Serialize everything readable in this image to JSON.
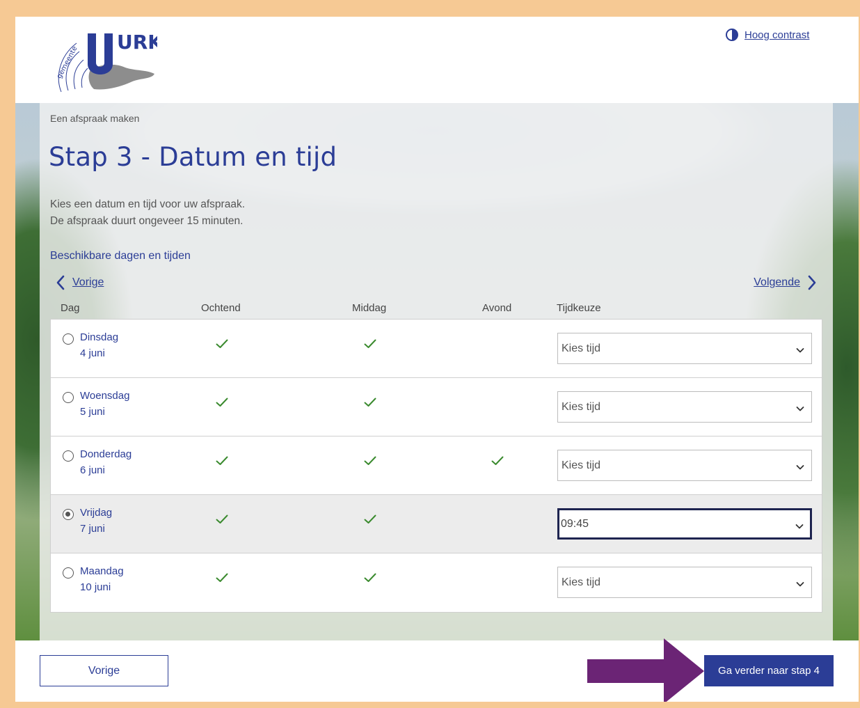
{
  "header": {
    "logo_text": "URK",
    "logo_subtext": "gemeente",
    "contrast_label": "Hoog contrast"
  },
  "breadcrumb": "Een afspraak maken",
  "title": "Stap 3 - Datum en tijd",
  "intro": {
    "line1": "Kies een datum en tijd voor uw afspraak.",
    "line2": "De afspraak duurt ongeveer 15 minuten."
  },
  "section_title": "Beschikbare dagen en tijden",
  "nav": {
    "prev": "Vorige",
    "next": "Volgende"
  },
  "columns": {
    "day": "Dag",
    "morning": "Ochtend",
    "afternoon": "Middag",
    "evening": "Avond",
    "time": "Tijdkeuze"
  },
  "rows": [
    {
      "day": "Dinsdag",
      "date": "4 juni",
      "morning": true,
      "afternoon": true,
      "evening": false,
      "time": "Kies tijd",
      "selected": false
    },
    {
      "day": "Woensdag",
      "date": "5 juni",
      "morning": true,
      "afternoon": true,
      "evening": false,
      "time": "Kies tijd",
      "selected": false
    },
    {
      "day": "Donderdag",
      "date": "6 juni",
      "morning": true,
      "afternoon": true,
      "evening": true,
      "time": "Kies tijd",
      "selected": false
    },
    {
      "day": "Vrijdag",
      "date": "7 juni",
      "morning": true,
      "afternoon": true,
      "evening": false,
      "time": "09:45",
      "selected": true
    },
    {
      "day": "Maandag",
      "date": "10 juni",
      "morning": true,
      "afternoon": true,
      "evening": false,
      "time": "Kies tijd",
      "selected": false
    }
  ],
  "footer": {
    "prev_button": "Vorige",
    "next_button": "Ga verder naar stap 4"
  },
  "colors": {
    "brand": "#2b3d96",
    "check": "#3a8a2e",
    "arrow": "#6b2475",
    "frame": "#f6c994"
  }
}
